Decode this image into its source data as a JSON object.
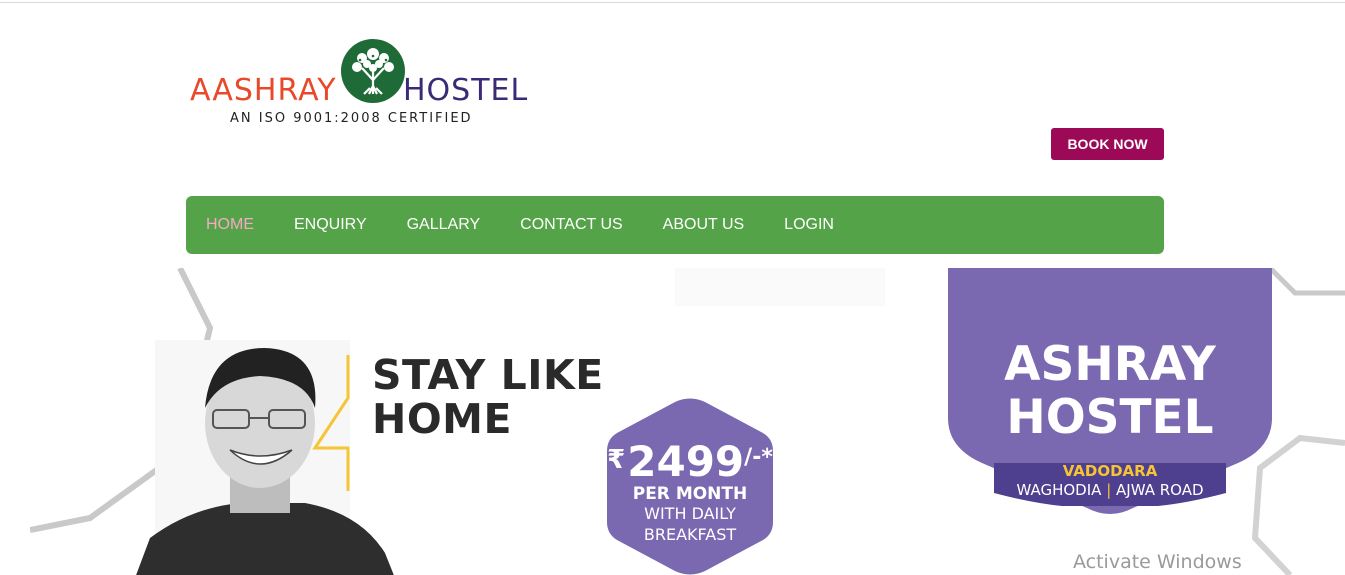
{
  "logo": {
    "word_left": "AASHRAY",
    "word_right": "HOSTEL",
    "tagline": "AN ISO 9001:2008 CERTIFIED",
    "icon": "tree-icon"
  },
  "header": {
    "book_label": "BOOK NOW"
  },
  "nav": {
    "items": [
      {
        "label": "HOME",
        "active": true
      },
      {
        "label": "ENQUIRY",
        "active": false
      },
      {
        "label": "GALLARY",
        "active": false
      },
      {
        "label": "CONTACT US",
        "active": false
      },
      {
        "label": "ABOUT US",
        "active": false
      },
      {
        "label": "LOGIN",
        "active": false
      }
    ]
  },
  "banner": {
    "headline_line1": "STAY LIKE",
    "headline_line2": "HOME",
    "price": {
      "currency": "₹",
      "amount": "2499",
      "suffix": "/-*",
      "line1": "PER MONTH",
      "line2": "WITH DAILY",
      "line3": "BREAKFAST"
    },
    "badge": {
      "title_line1": "ASHRAY",
      "title_line2": "HOSTEL",
      "city": "VADODARA",
      "road_left": "WAGHODIA",
      "road_sep": "|",
      "road_right": "AJWA ROAD"
    }
  },
  "watermark": "Activate Windows",
  "colors": {
    "nav_bg": "#55a348",
    "book_btn": "#9c0a57",
    "nav_active": "#f5a9c7",
    "badge_purple": "#7a68b0",
    "accent_yellow": "#f6c434"
  }
}
